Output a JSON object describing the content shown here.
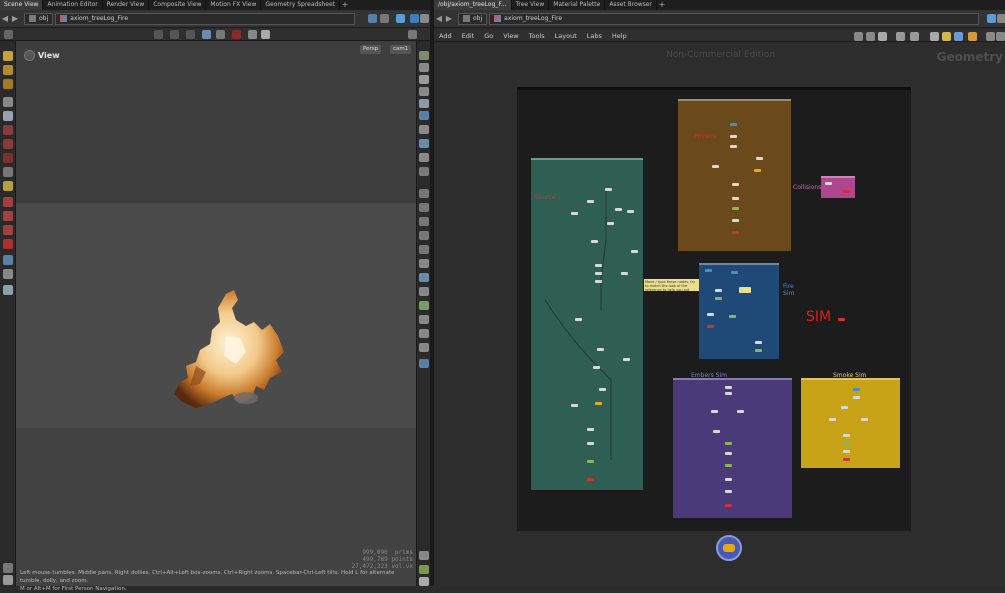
{
  "left_pane": {
    "tabs": [
      "Scene View",
      "Animation Editor",
      "Render View",
      "Composite View",
      "Motion FX View",
      "Geometry Spreadsheet"
    ],
    "active_tab": 0,
    "path": {
      "context": "obj",
      "node": "axiom_treeLog_Fire"
    },
    "viewport": {
      "title": "View",
      "camera_menu": "Persp",
      "camera_name": "cam1",
      "stats": [
        "999,090  prims",
        "499,789 points",
        "27,472,323 vol.vx"
      ],
      "help_text": "Left mouse tumbles. Middle pans. Right dollies. Ctrl+Alt+Left box-zooms. Ctrl+Right zooms. Spacebar-Ctrl-Left tilts. Hold L for alternate tumble, dolly, and zoom.",
      "help_text2": "M or Alt+M for First Person Navigation."
    }
  },
  "right_pane": {
    "tabs": [
      "/obj/axiom_treeLog_F...",
      "Tree View",
      "Material Palette",
      "Asset Browser"
    ],
    "active_tab": 0,
    "path": {
      "context": "obj",
      "node": "axiom_treeLog_Fire"
    },
    "menu": [
      "Add",
      "Edit",
      "Go",
      "View",
      "Tools",
      "Layout",
      "Labs",
      "Help"
    ],
    "watermark": "Non-Commercial Edition",
    "context_label": "Geometry",
    "network_boxes": [
      {
        "name": "Source",
        "color": "#2f5e52"
      },
      {
        "name": "Physics",
        "color": "#6a4a1a"
      },
      {
        "name": "Collisions",
        "color": "#b0478e"
      },
      {
        "name": "Fire Sim",
        "color": "#1f4a78"
      },
      {
        "name": "Embers Sim",
        "color": "#4a3a7a"
      },
      {
        "name": "Smoke Sim",
        "color": "#c9a317"
      }
    ],
    "sim_label": "SIM",
    "sticky_note": "Move / type these nodes, try to match the look of the reference to help you out"
  },
  "colors": {
    "accent": "#e6a817",
    "sim_red": "#e31d1d"
  }
}
